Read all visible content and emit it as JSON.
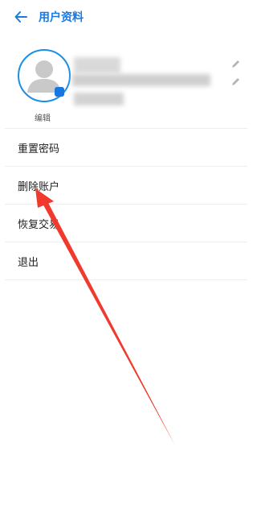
{
  "header": {
    "title": "用户资料",
    "back_icon": "arrow-left-icon"
  },
  "profile": {
    "avatar_icon": "user-avatar-icon",
    "edit_label": "编辑",
    "edit_icon": "pencil-icon"
  },
  "menu": {
    "items": [
      {
        "label": "重置密码"
      },
      {
        "label": "删除账户"
      },
      {
        "label": "恢复交易"
      },
      {
        "label": "退出"
      }
    ]
  },
  "annotation": {
    "arrow_color": "#f03a2e"
  },
  "colors": {
    "accent": "#1a7ae0"
  }
}
